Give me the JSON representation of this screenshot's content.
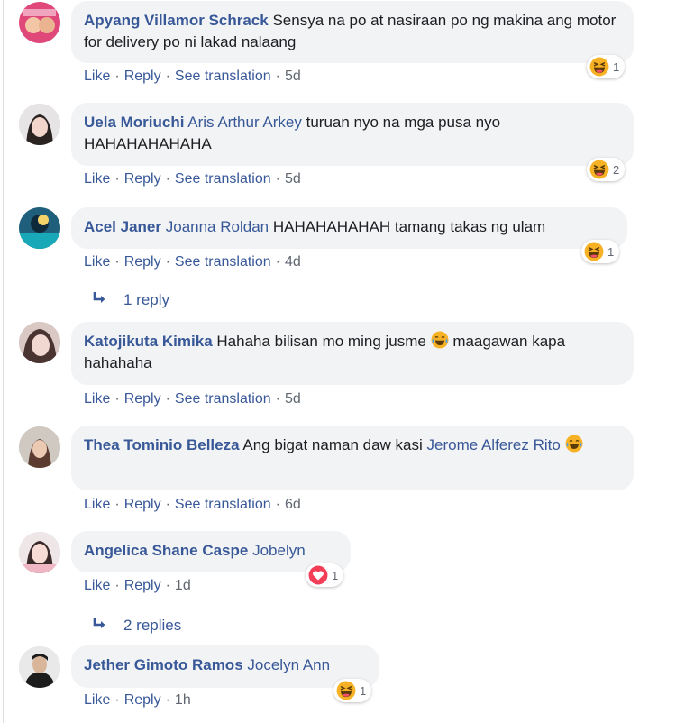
{
  "comments": [
    {
      "author": "Apyang Villamor Schrack",
      "mention": "",
      "text": "Sensya na po at nasiraan po ng makina ang motor for delivery po ni lakad nalaang",
      "reaction": {
        "type": "haha-icon",
        "count": "1"
      },
      "actions": {
        "like": "Like",
        "reply": "Reply",
        "translate": "See translation",
        "time": "5d"
      }
    },
    {
      "author": "Uela Moriuchi",
      "mention": "Aris Arthur Arkey",
      "text": "turuan nyo na mga pusa nyo HAHAHAHAHAHA",
      "reaction": {
        "type": "haha-icon",
        "count": "2"
      },
      "actions": {
        "like": "Like",
        "reply": "Reply",
        "translate": "See translation",
        "time": "5d"
      }
    },
    {
      "author": "Acel Janer",
      "mention": "Joanna Roldan",
      "text": "HAHAHAHAHAH tamang takas ng ulam",
      "reaction": {
        "type": "haha-icon",
        "count": "1"
      },
      "actions": {
        "like": "Like",
        "reply": "Reply",
        "translate": "See translation",
        "time": "4d"
      },
      "replies": "1 reply"
    },
    {
      "author": "Katojikuta Kimika",
      "mention": "",
      "text_before": "Hahaha bilisan mo ming jusme",
      "text_after": "maagawan kapa hahahaha",
      "actions": {
        "like": "Like",
        "reply": "Reply",
        "translate": "See translation",
        "time": "5d"
      }
    },
    {
      "author": "Thea Tominio Belleza",
      "mention": "Jerome Alferez Rito",
      "text_before": "Ang bigat naman daw kasi",
      "actions": {
        "like": "Like",
        "reply": "Reply",
        "translate": "See translation",
        "time": "6d"
      }
    },
    {
      "author": "Angelica Shane Caspe",
      "mention": "Jobelyn",
      "reaction": {
        "type": "love-icon",
        "count": "1"
      },
      "actions": {
        "like": "Like",
        "reply": "Reply",
        "time": "1d"
      },
      "replies": "2 replies"
    },
    {
      "author": "Jether Gimoto Ramos",
      "mention": "Jocelyn Ann",
      "reaction": {
        "type": "haha-icon",
        "count": "1"
      },
      "actions": {
        "like": "Like",
        "reply": "Reply",
        "time": "1h"
      }
    }
  ],
  "colors": {
    "link": "#385898",
    "meta": "#606770",
    "bubble": "#f2f3f5",
    "haha": "#f7b125",
    "love": "#f33e58"
  },
  "separator": "·"
}
